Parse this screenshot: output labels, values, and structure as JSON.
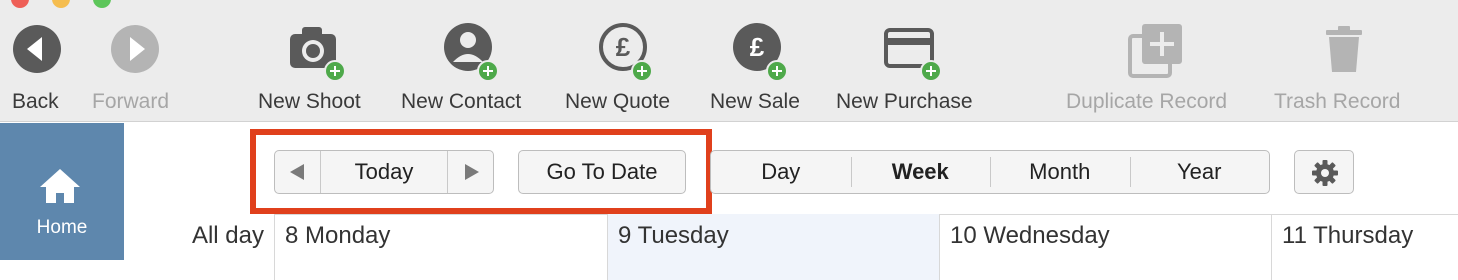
{
  "toolbar": {
    "back": {
      "label": "Back",
      "icon": "back-arrow-icon",
      "enabled": true
    },
    "forward": {
      "label": "Forward",
      "icon": "forward-arrow-icon",
      "enabled": false
    },
    "new_shoot": {
      "label": "New Shoot",
      "icon": "camera-icon"
    },
    "new_contact": {
      "label": "New Contact",
      "icon": "person-icon"
    },
    "new_quote": {
      "label": "New Quote",
      "icon": "pound-outline-icon"
    },
    "new_sale": {
      "label": "New Sale",
      "icon": "pound-filled-icon"
    },
    "new_purchase": {
      "label": "New Purchase",
      "icon": "credit-card-icon"
    },
    "duplicate_record": {
      "label": "Duplicate Record",
      "icon": "duplicate-icon",
      "enabled": false
    },
    "trash_record": {
      "label": "Trash Record",
      "icon": "trash-icon",
      "enabled": false
    }
  },
  "sidebar": {
    "home": {
      "label": "Home",
      "icon": "home-icon",
      "selected": true
    }
  },
  "calendar": {
    "nav": {
      "prev_icon": "left-triangle-icon",
      "today_label": "Today",
      "next_icon": "right-triangle-icon"
    },
    "goto_label": "Go To Date",
    "views": [
      {
        "label": "Day",
        "active": false
      },
      {
        "label": "Week",
        "active": true
      },
      {
        "label": "Month",
        "active": false
      },
      {
        "label": "Year",
        "active": false
      }
    ],
    "settings_icon": "gear-icon",
    "allday_label": "All day",
    "days": [
      {
        "label": "8 Monday",
        "today": false
      },
      {
        "label": "9 Tuesday",
        "today": true
      },
      {
        "label": "10 Wednesday",
        "today": false
      },
      {
        "label": "11 Thursday",
        "today": false
      }
    ]
  },
  "colors": {
    "accent_highlight": "#e0401c",
    "sidebar_bg": "#5e87ad",
    "add_badge": "#4ea94a",
    "toolbar_bg": "#ececec"
  }
}
